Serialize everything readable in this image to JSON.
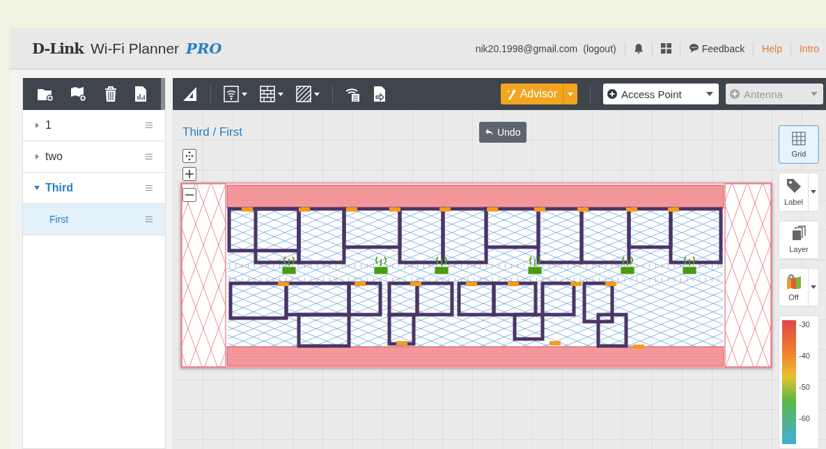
{
  "header": {
    "brand": "D-Link",
    "product": "Wi-Fi Planner",
    "edition": "PRO",
    "user": {
      "email": "nik20.1998@gmail.com",
      "logout": "(logout)"
    },
    "links": [
      {
        "kind": "bell"
      },
      {
        "kind": "apps"
      },
      {
        "kind": "feedback",
        "label": "Feedback"
      },
      {
        "kind": "link",
        "label": "Help"
      },
      {
        "kind": "link",
        "label": "Intro"
      }
    ]
  },
  "sidebar": {
    "tools": [
      {
        "kind": "folder-add"
      },
      {
        "kind": "map-add"
      },
      {
        "kind": "trash"
      },
      {
        "kind": "report"
      }
    ],
    "tree": [
      {
        "label": "1",
        "expanded": false,
        "selected": false
      },
      {
        "label": "two",
        "expanded": false,
        "selected": false
      },
      {
        "label": "Third",
        "expanded": true,
        "selected": false,
        "children": [
          {
            "label": "First",
            "selected": true
          }
        ]
      }
    ]
  },
  "toolbar": {
    "tools": [
      {
        "kind": "ruler",
        "dropdown": false
      },
      {
        "kind": "wifi-zone",
        "dropdown": true
      },
      {
        "kind": "wall",
        "dropdown": true
      },
      {
        "kind": "area",
        "dropdown": true
      },
      {
        "kind": "ap-list",
        "dropdown": false
      },
      {
        "kind": "export",
        "dropdown": false
      }
    ],
    "advisor": {
      "label": "Advisor"
    },
    "device_select": {
      "value": "Access Point",
      "disabled": false
    },
    "antenna_select": {
      "value": "Antenna",
      "disabled": true
    }
  },
  "canvas": {
    "breadcrumb": "Third / First",
    "undo": "Undo"
  },
  "right_tools": [
    {
      "kind": "grid",
      "label": "Grid",
      "selected": true,
      "dropdown": false
    },
    {
      "kind": "label",
      "label": "Label",
      "selected": false,
      "dropdown": true
    },
    {
      "kind": "layer",
      "label": "Layer",
      "selected": false,
      "dropdown": false
    },
    {
      "kind": "map",
      "label": "Off",
      "selected": false,
      "dropdown": true
    }
  ],
  "legend": {
    "ticks": [
      "-30",
      "-40",
      "-50",
      "-60"
    ]
  }
}
